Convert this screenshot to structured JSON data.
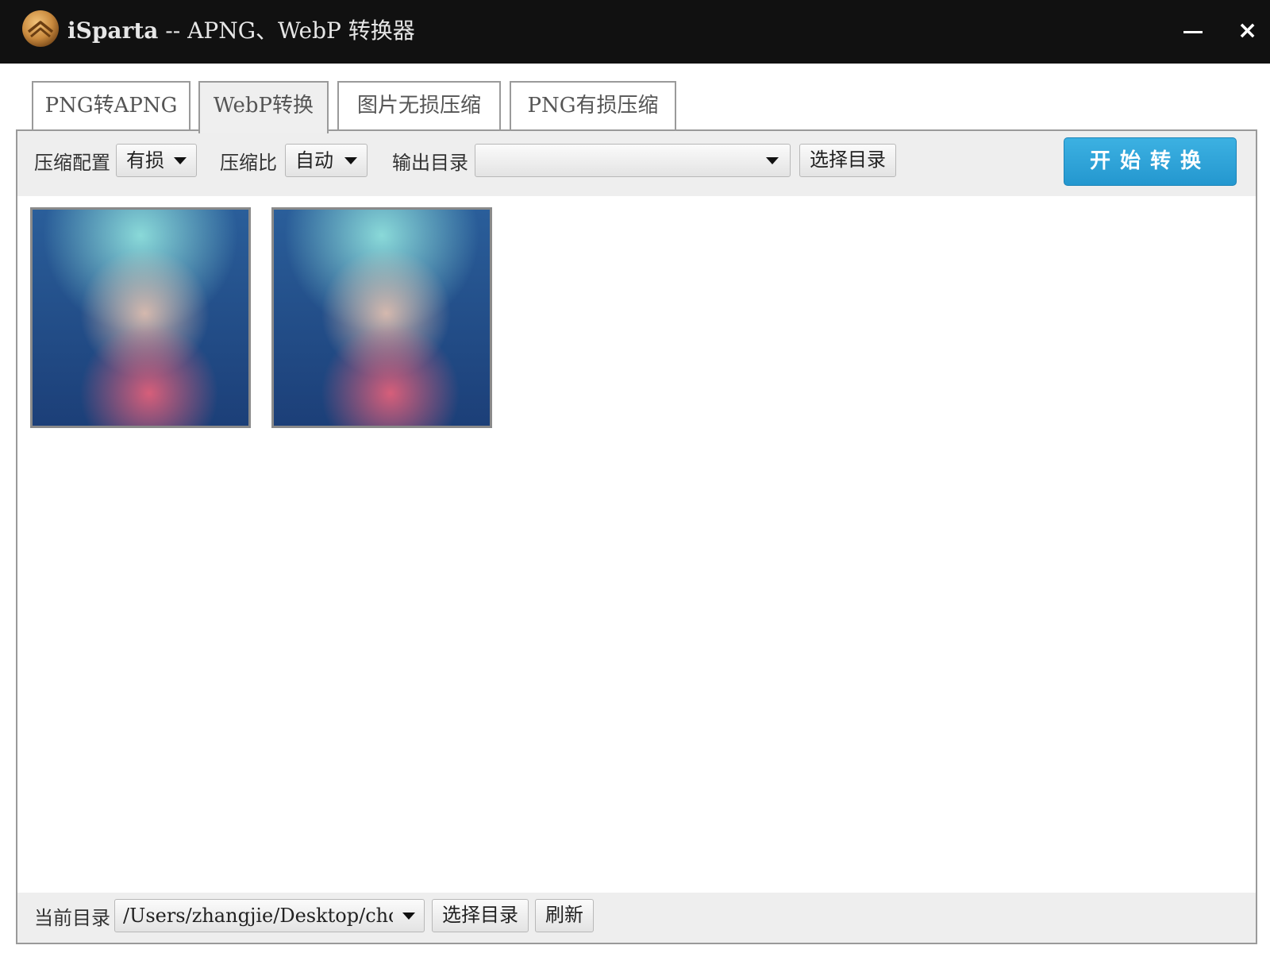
{
  "window": {
    "title_brand": "iSparta",
    "title_rest": " -- APNG、WebP 转换器",
    "minimize_icon": "minimize-icon",
    "close_glyph": "×"
  },
  "tabs": [
    {
      "label": "PNG转APNG",
      "active": false
    },
    {
      "label": "WebP转换",
      "active": true
    },
    {
      "label": "图片无损压缩",
      "active": false
    },
    {
      "label": "PNG有损压缩",
      "active": false
    }
  ],
  "toolbar": {
    "compress_config_label": "压缩配置",
    "compress_config_value": "有损",
    "compress_ratio_label": "压缩比",
    "compress_ratio_value": "自动",
    "output_dir_label": "输出目录",
    "output_dir_value": "",
    "choose_dir_button": "选择目录",
    "start_button": "开始转换"
  },
  "thumbnails": [
    {
      "kind": "image-thumbnail"
    },
    {
      "kind": "image-thumbnail"
    }
  ],
  "bottombar": {
    "current_dir_label": "当前目录",
    "current_dir_value": "/Users/zhangjie/Desktop/chonger/apl",
    "choose_dir_button": "选择目录",
    "refresh_button": "刷新"
  },
  "colors": {
    "titlebar_bg": "#111111",
    "primary_button": "#2a9fd6",
    "toolbar_bg": "#eeeeee"
  }
}
